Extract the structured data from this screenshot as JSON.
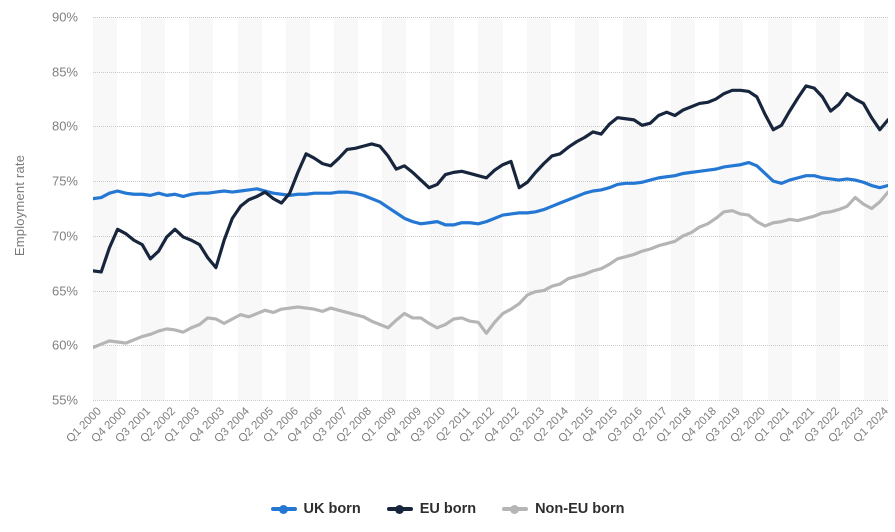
{
  "chart_data": {
    "type": "line",
    "title": "",
    "xlabel": "",
    "ylabel": "Employment rate",
    "ylim": [
      55,
      90
    ],
    "yticks": [
      55,
      60,
      65,
      70,
      75,
      80,
      85,
      90
    ],
    "ytick_labels": [
      "55%",
      "60%",
      "65%",
      "70%",
      "75%",
      "80%",
      "85%",
      "90%"
    ],
    "grid": "horizontal-dotted",
    "legend_position": "bottom",
    "x": [
      "Q1 2000",
      "Q2 2000",
      "Q3 2000",
      "Q4 2000",
      "Q1 2001",
      "Q2 2001",
      "Q3 2001",
      "Q4 2001",
      "Q1 2002",
      "Q2 2002",
      "Q3 2002",
      "Q4 2002",
      "Q1 2003",
      "Q2 2003",
      "Q3 2003",
      "Q4 2003",
      "Q1 2004",
      "Q2 2004",
      "Q3 2004",
      "Q4 2004",
      "Q1 2005",
      "Q2 2005",
      "Q3 2005",
      "Q4 2005",
      "Q1 2006",
      "Q2 2006",
      "Q3 2006",
      "Q4 2006",
      "Q1 2007",
      "Q2 2007",
      "Q3 2007",
      "Q4 2007",
      "Q1 2008",
      "Q2 2008",
      "Q3 2008",
      "Q4 2008",
      "Q1 2009",
      "Q2 2009",
      "Q3 2009",
      "Q4 2009",
      "Q1 2010",
      "Q2 2010",
      "Q3 2010",
      "Q4 2010",
      "Q1 2011",
      "Q2 2011",
      "Q3 2011",
      "Q4 2011",
      "Q1 2012",
      "Q2 2012",
      "Q3 2012",
      "Q4 2012",
      "Q1 2013",
      "Q2 2013",
      "Q3 2013",
      "Q4 2013",
      "Q1 2014",
      "Q2 2014",
      "Q3 2014",
      "Q4 2014",
      "Q1 2015",
      "Q2 2015",
      "Q3 2015",
      "Q4 2015",
      "Q1 2016",
      "Q2 2016",
      "Q3 2016",
      "Q4 2016",
      "Q1 2017",
      "Q2 2017",
      "Q3 2017",
      "Q4 2017",
      "Q1 2018",
      "Q2 2018",
      "Q3 2018",
      "Q4 2018",
      "Q1 2019",
      "Q2 2019",
      "Q3 2019",
      "Q4 2019",
      "Q1 2020",
      "Q2 2020",
      "Q3 2020",
      "Q4 2020",
      "Q1 2021",
      "Q2 2021",
      "Q3 2021",
      "Q4 2021",
      "Q1 2022",
      "Q2 2022",
      "Q3 2022",
      "Q4 2022",
      "Q1 2023",
      "Q2 2023",
      "Q3 2023",
      "Q4 2023",
      "Q1 2024",
      "Q2 2024"
    ],
    "xtick_labels": [
      "Q1 2000",
      "Q4 2000",
      "Q3 2001",
      "Q2 2002",
      "Q1 2003",
      "Q4 2003",
      "Q3 2004",
      "Q2 2005",
      "Q1 2006",
      "Q4 2006",
      "Q3 2007",
      "Q2 2008",
      "Q1 2009",
      "Q4 2009",
      "Q3 2010",
      "Q2 2011",
      "Q1 2012",
      "Q4 2012",
      "Q3 2013",
      "Q2 2014",
      "Q1 2015",
      "Q4 2015",
      "Q3 2016",
      "Q2 2017",
      "Q1 2018",
      "Q4 2018",
      "Q3 2019",
      "Q2 2020",
      "Q1 2021",
      "Q4 2021",
      "Q3 2022",
      "Q2 2023",
      "Q1 2024"
    ],
    "xtick_indices": [
      0,
      3,
      6,
      9,
      12,
      15,
      18,
      21,
      24,
      27,
      30,
      33,
      36,
      39,
      42,
      45,
      48,
      51,
      54,
      57,
      60,
      63,
      66,
      69,
      72,
      75,
      78,
      81,
      84,
      87,
      90,
      93,
      96
    ],
    "series": [
      {
        "name": "UK born",
        "color": "#2478D4",
        "values": [
          73.4,
          73.5,
          73.9,
          74.1,
          73.9,
          73.8,
          73.8,
          73.7,
          73.9,
          73.7,
          73.8,
          73.6,
          73.8,
          73.9,
          73.9,
          74.0,
          74.1,
          74.0,
          74.1,
          74.2,
          74.3,
          74.1,
          73.9,
          73.8,
          73.7,
          73.8,
          73.8,
          73.9,
          73.9,
          73.9,
          74.0,
          74.0,
          73.9,
          73.7,
          73.4,
          73.1,
          72.6,
          72.1,
          71.6,
          71.3,
          71.1,
          71.2,
          71.3,
          71.0,
          71.0,
          71.2,
          71.2,
          71.1,
          71.3,
          71.6,
          71.9,
          72.0,
          72.1,
          72.1,
          72.2,
          72.4,
          72.7,
          73.0,
          73.3,
          73.6,
          73.9,
          74.1,
          74.2,
          74.4,
          74.7,
          74.8,
          74.8,
          74.9,
          75.1,
          75.3,
          75.4,
          75.5,
          75.7,
          75.8,
          75.9,
          76.0,
          76.1,
          76.3,
          76.4,
          76.5,
          76.7,
          76.4,
          75.7,
          75.0,
          74.8,
          75.1,
          75.3,
          75.5,
          75.5,
          75.3,
          75.2,
          75.1,
          75.2,
          75.1,
          74.9,
          74.6,
          74.4,
          74.6
        ]
      },
      {
        "name": "EU born",
        "color": "#17263D",
        "values": [
          66.8,
          66.7,
          68.9,
          70.6,
          70.2,
          69.6,
          69.2,
          67.9,
          68.6,
          69.9,
          70.6,
          69.9,
          69.6,
          69.2,
          68.0,
          67.1,
          69.6,
          71.6,
          72.7,
          73.3,
          73.6,
          74.0,
          73.4,
          73.0,
          73.9,
          75.8,
          77.5,
          77.1,
          76.6,
          76.4,
          77.1,
          77.9,
          78.0,
          78.2,
          78.4,
          78.2,
          77.3,
          76.1,
          76.4,
          75.8,
          75.1,
          74.4,
          74.7,
          75.6,
          75.8,
          75.9,
          75.7,
          75.5,
          75.3,
          76.0,
          76.5,
          76.8,
          74.4,
          74.9,
          75.8,
          76.6,
          77.3,
          77.5,
          78.1,
          78.6,
          79.0,
          79.5,
          79.3,
          80.2,
          80.8,
          80.7,
          80.6,
          80.1,
          80.3,
          81.0,
          81.3,
          81.0,
          81.5,
          81.8,
          82.1,
          82.2,
          82.5,
          83.0,
          83.3,
          83.3,
          83.2,
          82.7,
          81.1,
          79.7,
          80.1,
          81.4,
          82.6,
          83.7,
          83.5,
          82.7,
          81.4,
          82.0,
          83.0,
          82.5,
          82.1,
          80.8,
          79.7,
          80.6
        ]
      },
      {
        "name": "Non-EU born",
        "color": "#B5B5B5",
        "values": [
          59.8,
          60.1,
          60.4,
          60.3,
          60.2,
          60.5,
          60.8,
          61.0,
          61.3,
          61.5,
          61.4,
          61.2,
          61.6,
          61.9,
          62.5,
          62.4,
          62.0,
          62.4,
          62.8,
          62.6,
          62.9,
          63.2,
          63.0,
          63.3,
          63.4,
          63.5,
          63.4,
          63.3,
          63.1,
          63.4,
          63.2,
          63.0,
          62.8,
          62.6,
          62.2,
          61.9,
          61.6,
          62.3,
          62.9,
          62.5,
          62.5,
          62.0,
          61.6,
          61.9,
          62.4,
          62.5,
          62.2,
          62.1,
          61.1,
          62.1,
          62.9,
          63.3,
          63.8,
          64.6,
          64.9,
          65.0,
          65.4,
          65.6,
          66.1,
          66.3,
          66.5,
          66.8,
          67.0,
          67.4,
          67.9,
          68.1,
          68.3,
          68.6,
          68.8,
          69.1,
          69.3,
          69.5,
          70.0,
          70.3,
          70.8,
          71.1,
          71.6,
          72.2,
          72.3,
          72.0,
          71.9,
          71.3,
          70.9,
          71.2,
          71.3,
          71.5,
          71.4,
          71.6,
          71.8,
          72.1,
          72.2,
          72.4,
          72.7,
          73.5,
          72.9,
          72.5,
          73.1,
          74.0
        ]
      }
    ]
  },
  "legend": {
    "items": [
      {
        "label": "UK born",
        "color": "#2478D4"
      },
      {
        "label": "EU born",
        "color": "#17263D"
      },
      {
        "label": "Non-EU born",
        "color": "#B5B5B5"
      }
    ]
  },
  "axis": {
    "y_title": "Employment rate"
  }
}
